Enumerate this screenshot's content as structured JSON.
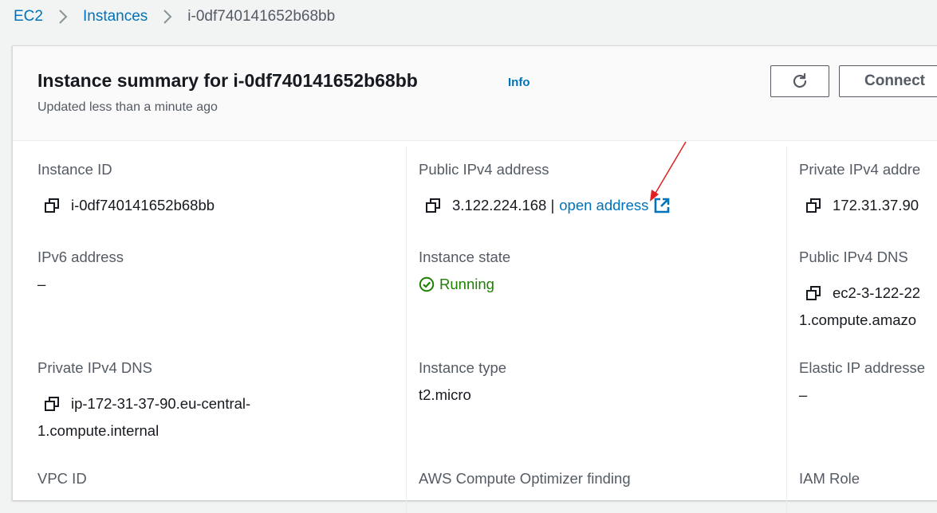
{
  "breadcrumb": {
    "items": [
      {
        "label": "EC2"
      },
      {
        "label": "Instances"
      },
      {
        "label": "i-0df740141652b68bb"
      }
    ]
  },
  "header": {
    "title": "Instance summary for i-0df740141652b68bb",
    "info_label": "Info",
    "subtitle": "Updated less than a minute ago",
    "refresh_icon": "refresh-icon",
    "connect_label": "Connect"
  },
  "fields": {
    "instance_id": {
      "label": "Instance ID",
      "value": "i-0df740141652b68bb"
    },
    "public_ipv4": {
      "label": "Public IPv4 address",
      "value": "3.122.224.168 |",
      "link": "open address"
    },
    "private_ipv4": {
      "label": "Private IPv4 addre",
      "value": "172.31.37.90"
    },
    "ipv6": {
      "label": "IPv6 address",
      "value": "–"
    },
    "instance_state": {
      "label": "Instance state",
      "value": "Running"
    },
    "public_dns": {
      "label": "Public IPv4 DNS",
      "value_line1": "ec2-3-122-22",
      "value_line2": "1.compute.amazo"
    },
    "private_dns": {
      "label": "Private IPv4 DNS",
      "value_line1": "ip-172-31-37-90.eu-central-",
      "value_line2": "1.compute.internal"
    },
    "instance_type": {
      "label": "Instance type",
      "value": "t2.micro"
    },
    "elastic_ip": {
      "label": "Elastic IP addresse",
      "value": "–"
    },
    "vpc_id": {
      "label": "VPC ID"
    },
    "optimizer": {
      "label": "AWS Compute Optimizer finding"
    },
    "iam_role": {
      "label": "IAM Role"
    }
  },
  "colors": {
    "link": "#0073bb",
    "running": "#1d8102",
    "annotation_arrow": "#e02020"
  }
}
